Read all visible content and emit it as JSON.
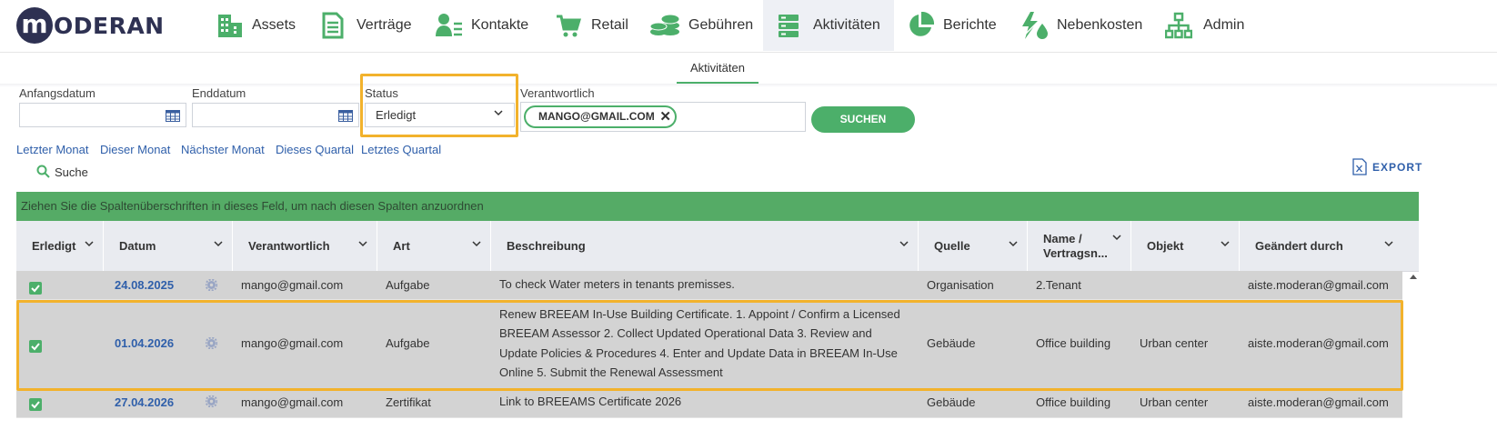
{
  "app": {
    "logo_letter": "m",
    "logo_text": "ODERAN"
  },
  "nav": [
    {
      "label": "Assets",
      "icon": "building-icon"
    },
    {
      "label": "Verträge",
      "icon": "document-icon"
    },
    {
      "label": "Kontakte",
      "icon": "contact-icon"
    },
    {
      "label": "Retail",
      "icon": "cart-icon"
    },
    {
      "label": "Gebühren",
      "icon": "coins-icon"
    },
    {
      "label": "Aktivitäten",
      "icon": "server-icon",
      "active": true
    },
    {
      "label": "Berichte",
      "icon": "pie-chart-icon"
    },
    {
      "label": "Nebenkosten",
      "icon": "utilities-icon"
    },
    {
      "label": "Admin",
      "icon": "org-chart-icon"
    }
  ],
  "subtab": {
    "label": "Aktivitäten"
  },
  "filters": {
    "start_label": "Anfangsdatum",
    "start_value": "",
    "end_label": "Enddatum",
    "end_value": "",
    "status_label": "Status",
    "status_value": "Erledigt",
    "responsible_label": "Verantwortlich",
    "responsible_chip": "MANGO@GMAIL.COM",
    "search_button": "SUCHEN"
  },
  "quick_links": [
    "Letzter Monat",
    "Dieser Monat",
    "Nächster Monat",
    "Dieses Quartal",
    "Letztes Quartal"
  ],
  "suche_label": "Suche",
  "export_label": "EXPORT",
  "grid": {
    "group_hint": "Ziehen Sie die Spaltenüberschriften in dieses Feld, um nach diesen Spalten anzuordnen",
    "columns": [
      "Erledigt",
      "Datum",
      "Verantwortlich",
      "Art",
      "Beschreibung",
      "Quelle",
      "Name / Vertragsn...",
      "Objekt",
      "Geändert durch"
    ],
    "rows": [
      {
        "done": true,
        "date": "24.08.2025",
        "responsible": "mango@gmail.com",
        "type": "Aufgabe",
        "description": [
          "To check Water meters in tenants premisses."
        ],
        "source": "Organisation",
        "name": "2.Tenant",
        "object": "",
        "changed_by": "aiste.moderan@gmail.com"
      },
      {
        "done": true,
        "date": "01.04.2026",
        "responsible": "mango@gmail.com",
        "type": "Aufgabe",
        "description": [
          "Renew BREEAM In-Use Building Certificate. 1. Appoint / Confirm a Licensed",
          "BREEAM Assessor 2. Collect Updated Operational Data 3. Review and",
          "Update Policies & Procedures 4. Enter and Update Data in BREEAM In-Use",
          "Online 5. Submit the Renewal Assessment"
        ],
        "source": "Gebäude",
        "name": "Office building",
        "object": "Urban center",
        "changed_by": "aiste.moderan@gmail.com"
      },
      {
        "done": true,
        "date": "27.04.2026",
        "responsible": "mango@gmail.com",
        "type": "Zertifikat",
        "description": [
          "Link to BREEAMS Certificate 2026"
        ],
        "source": "Gebäude",
        "name": "Office building",
        "object": "Urban center",
        "changed_by": "aiste.moderan@gmail.com"
      }
    ]
  },
  "colors": {
    "accent": "#4caf6a",
    "link": "#2f5faa",
    "highlight": "#f2b22c",
    "brand": "#2e3152"
  }
}
